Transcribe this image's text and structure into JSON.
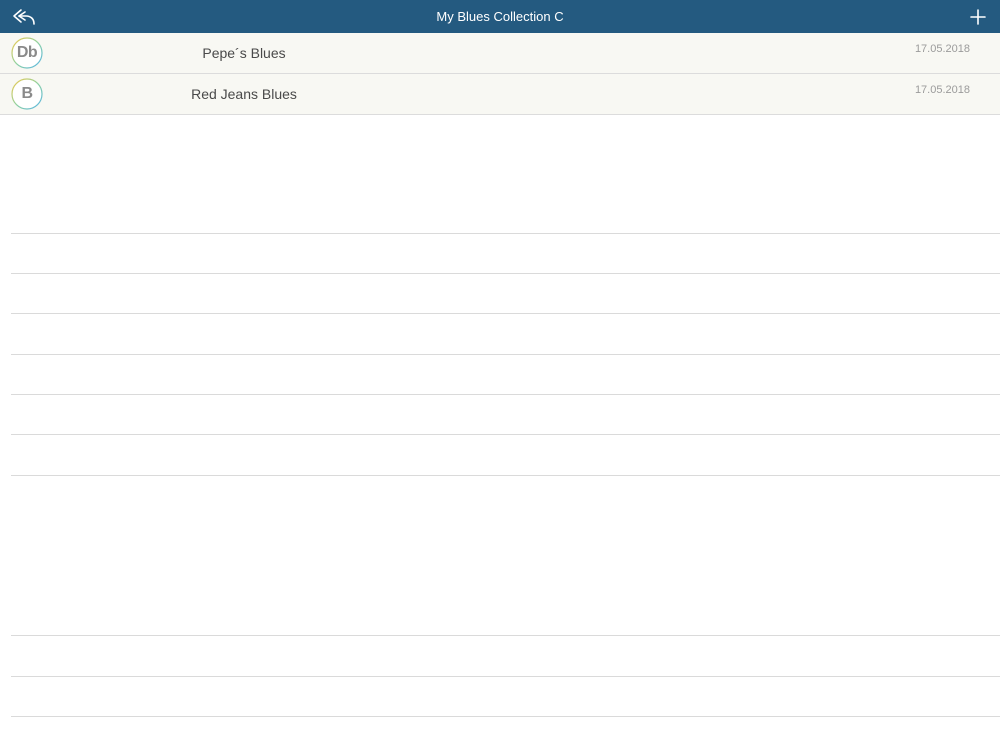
{
  "header": {
    "title": "My Blues Collection C",
    "back_icon": "reply-back-icon",
    "add_icon": "plus-icon",
    "background": "#245a80"
  },
  "songs": [
    {
      "key": "Db",
      "title": "Pepe´s Blues",
      "date": "17.05.2018"
    },
    {
      "key": "B",
      "title": "Red Jeans Blues",
      "date": "17.05.2018"
    }
  ],
  "colors": {
    "row_background": "#f8f8f3",
    "separator": "#dadada"
  }
}
